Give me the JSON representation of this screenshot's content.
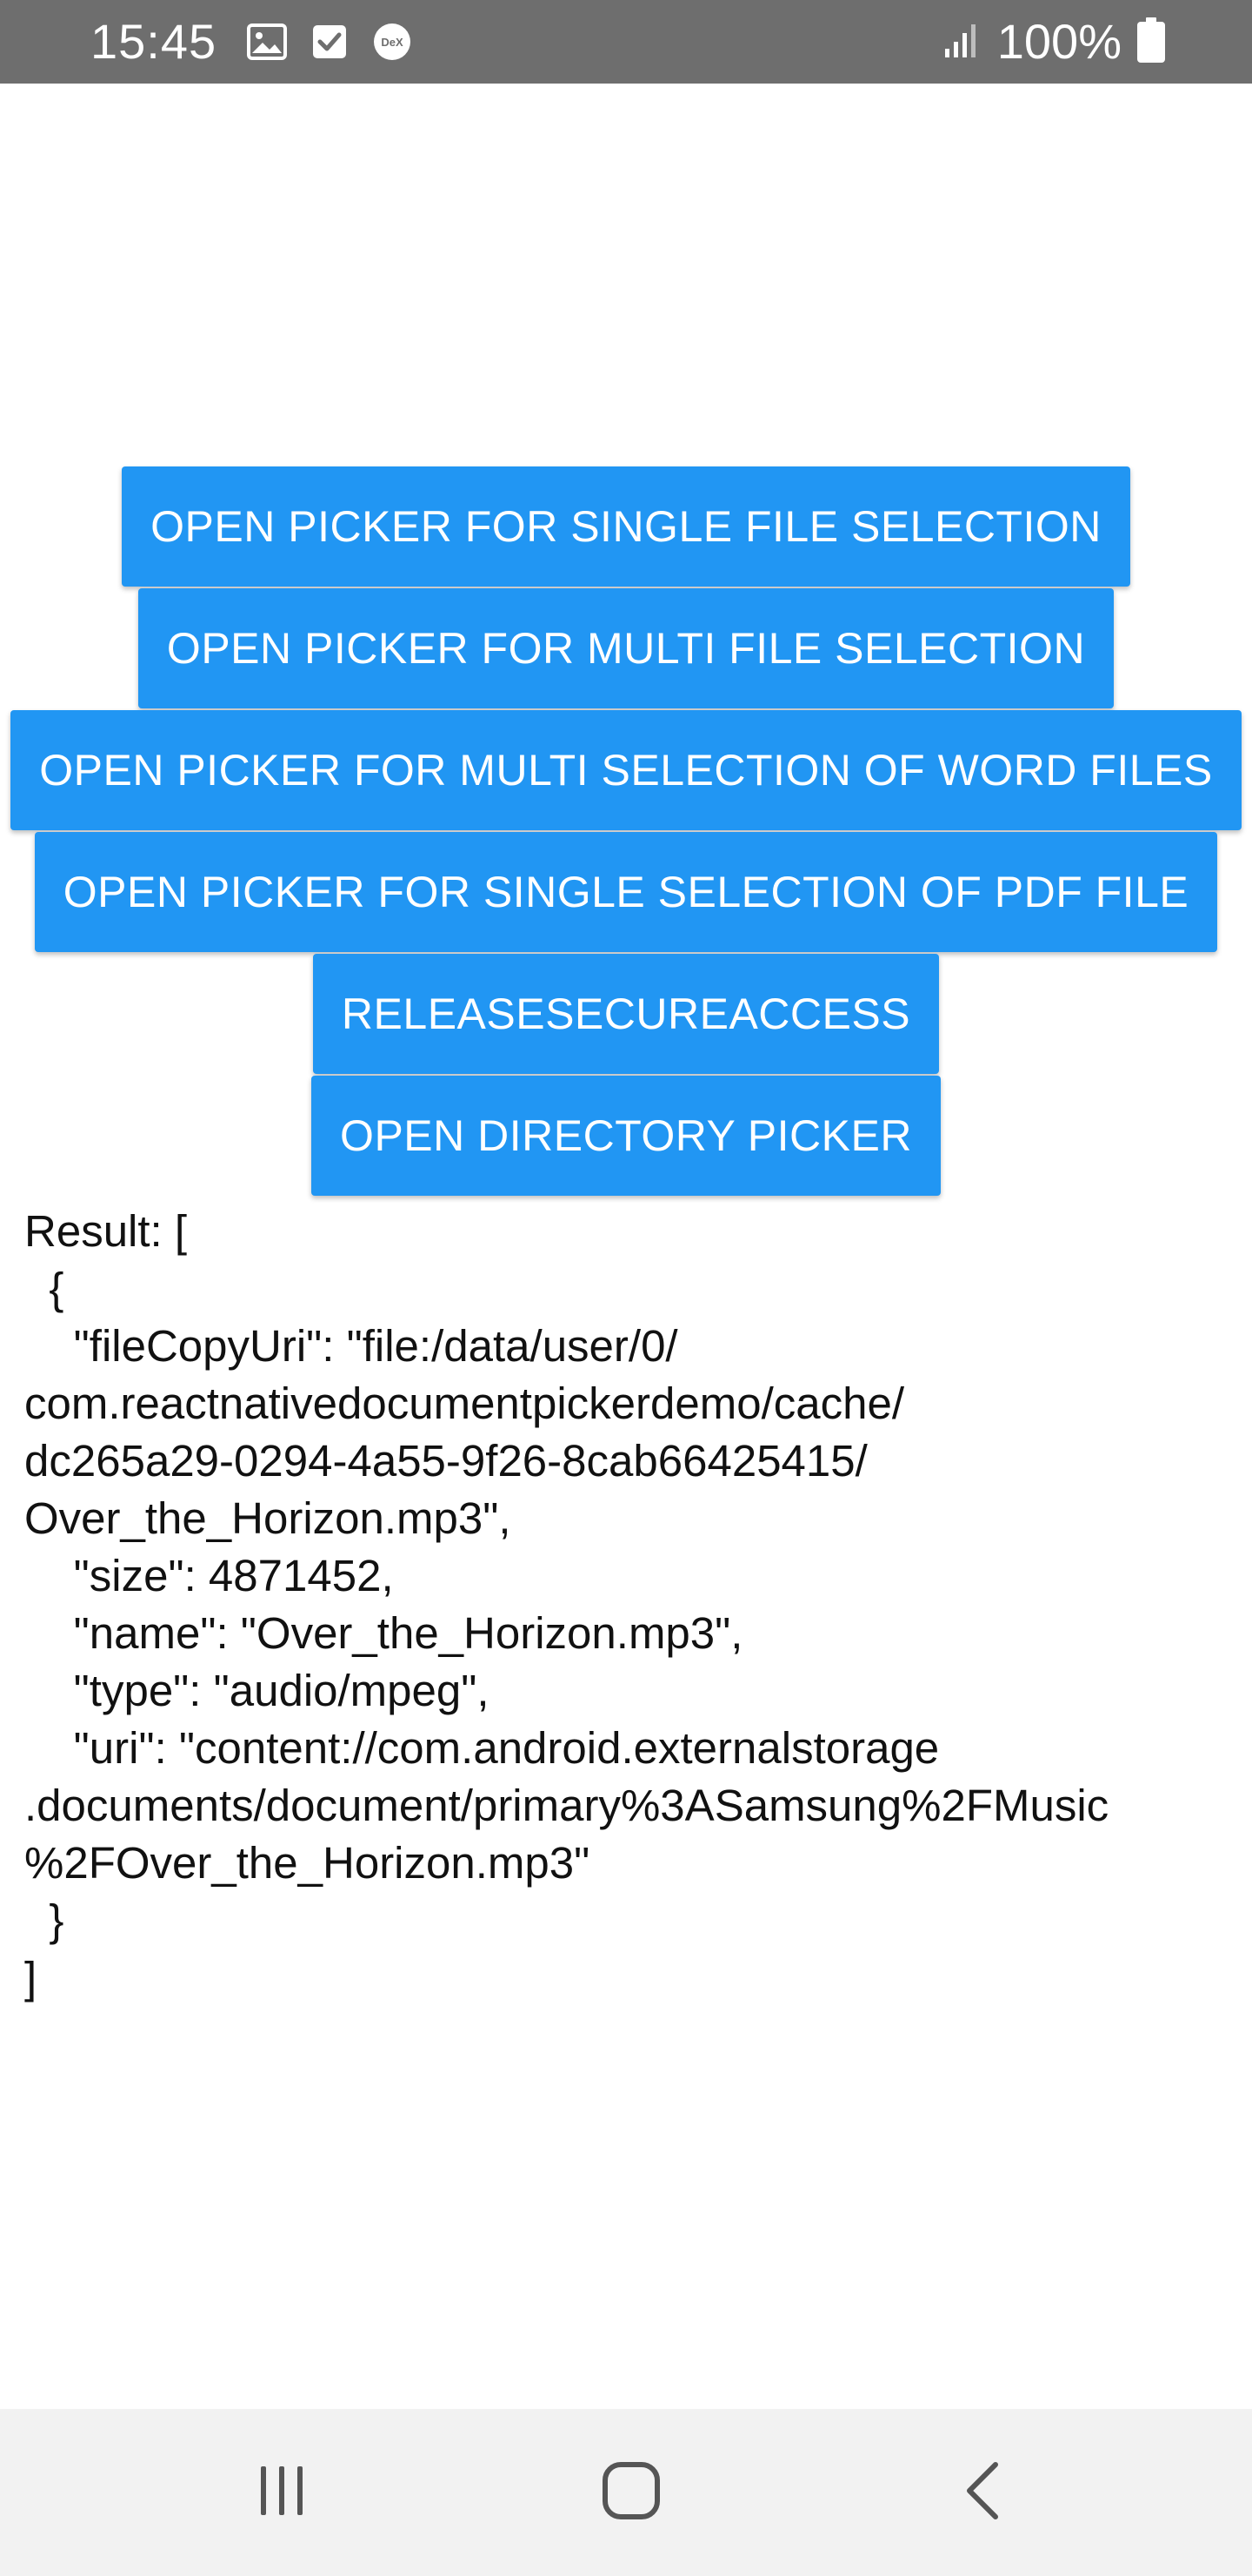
{
  "status_bar": {
    "time": "15:45",
    "battery_text": "100%",
    "icons_left": [
      "image-icon",
      "checkbox-icon",
      "dex-icon"
    ],
    "dex_label": "DeX",
    "icons_right": [
      "signal-icon",
      "battery-icon"
    ]
  },
  "buttons": [
    {
      "label": "OPEN PICKER FOR SINGLE FILE SELECTION"
    },
    {
      "label": "OPEN PICKER FOR MULTI FILE SELECTION"
    },
    {
      "label": "OPEN PICKER FOR MULTI SELECTION OF WORD FILES"
    },
    {
      "label": "OPEN PICKER FOR SINGLE SELECTION OF PDF FILE"
    },
    {
      "label": "RELEASESECUREACCESS"
    },
    {
      "label": "OPEN DIRECTORY PICKER"
    }
  ],
  "result": {
    "text": "Result: [\n  {\n    \"fileCopyUri\": \"file:/data/user/0/\ncom.reactnativedocumentpickerdemo/cache/\ndc265a29-0294-4a55-9f26-8cab66425415/\nOver_the_Horizon.mp3\",\n    \"size\": 4871452,\n    \"name\": \"Over_the_Horizon.mp3\",\n    \"type\": \"audio/mpeg\",\n    \"uri\": \"content://com.android.externalstorage\n.documents/document/primary%3ASamsung%2FMusic\n%2FOver_the_Horizon.mp3\"\n  }\n]"
  },
  "nav_bar": {
    "icons": [
      "recent-apps-icon",
      "home-icon",
      "back-icon"
    ]
  },
  "colors": {
    "status_bar": "#6e6e6e",
    "button": "#2196f3",
    "button_text": "#ffffff",
    "nav_bar": "#f2f2f2"
  }
}
